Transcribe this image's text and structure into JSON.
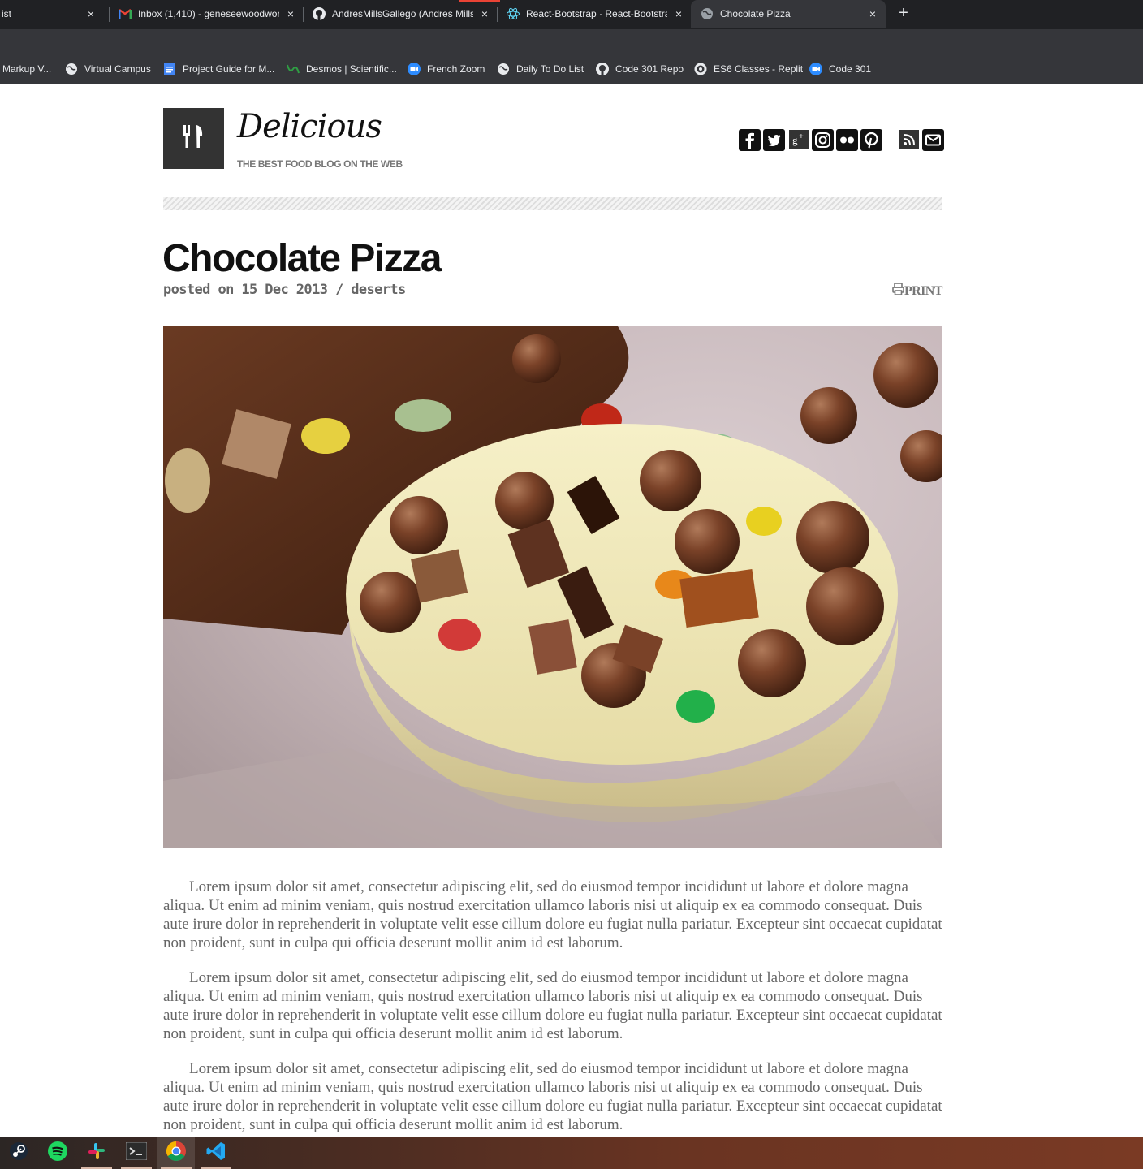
{
  "browser": {
    "tabs": [
      {
        "title": "ist",
        "icon": "page-icon"
      },
      {
        "title": "Inbox (1,410) - geneseewoodwor",
        "icon": "gmail-icon"
      },
      {
        "title": "AndresMillsGallego (Andres Mills",
        "icon": "github-icon"
      },
      {
        "title": "React-Bootstrap · React-Bootstrap",
        "icon": "react-bootstrap-icon"
      },
      {
        "title": "Chocolate Pizza",
        "icon": "globe-icon",
        "active": true
      }
    ],
    "new_tab_label": "+",
    "close_label": "×",
    "bookmarks": [
      {
        "label": "Markup V...",
        "icon": "page-icon"
      },
      {
        "label": "Virtual Campus",
        "icon": "globe-icon"
      },
      {
        "label": "Project Guide for M...",
        "icon": "docs-icon"
      },
      {
        "label": "Desmos | Scientific...",
        "icon": "desmos-icon"
      },
      {
        "label": "French Zoom",
        "icon": "zoom-icon"
      },
      {
        "label": "Daily To Do List",
        "icon": "globe-icon"
      },
      {
        "label": "Code 301 Repo",
        "icon": "github-icon"
      },
      {
        "label": "ES6 Classes - Replit",
        "icon": "replit-icon"
      },
      {
        "label": "Code 301",
        "icon": "zoom-icon"
      }
    ]
  },
  "site": {
    "brand": "Delicious",
    "tagline": "THE BEST FOOD BLOG ON THE WEB",
    "social_icons": [
      "facebook-icon",
      "twitter-icon",
      "google-plus-icon",
      "instagram-icon",
      "flickr-icon",
      "pinterest-icon",
      "rss-icon",
      "email-icon"
    ]
  },
  "post": {
    "title": "Chocolate Pizza",
    "meta": "posted on 15 Dec 2013 / deserts",
    "print_label": "PRINT",
    "paragraphs": [
      "Lorem ipsum dolor sit amet, consectetur adipiscing elit, sed do eiusmod tempor incididunt ut labore et dolore magna aliqua. Ut enim ad minim veniam, quis nostrud exercitation ullamco laboris nisi ut aliquip ex ea commodo consequat. Duis aute irure dolor in reprehenderit in voluptate velit esse cillum dolore eu fugiat nulla pariatur. Excepteur sint occaecat cupidatat non proident, sunt in culpa qui officia deserunt mollit anim id est laborum.",
      "Lorem ipsum dolor sit amet, consectetur adipiscing elit, sed do eiusmod tempor incididunt ut labore et dolore magna aliqua. Ut enim ad minim veniam, quis nostrud exercitation ullamco laboris nisi ut aliquip ex ea commodo consequat. Duis aute irure dolor in reprehenderit in voluptate velit esse cillum dolore eu fugiat nulla pariatur. Excepteur sint occaecat cupidatat non proident, sunt in culpa qui officia deserunt mollit anim id est laborum.",
      "Lorem ipsum dolor sit amet, consectetur adipiscing elit, sed do eiusmod tempor incididunt ut labore et dolore magna aliqua. Ut enim ad minim veniam, quis nostrud exercitation ullamco laboris nisi ut aliquip ex ea commodo consequat. Duis aute irure dolor in reprehenderit in voluptate velit esse cillum dolore eu fugiat nulla pariatur. Excepteur sint occaecat cupidatat non proident, sunt in culpa qui officia deserunt mollit anim id est laborum."
    ]
  },
  "taskbar": {
    "apps": [
      "steam-icon",
      "spotify-icon",
      "slack-icon",
      "terminal-icon",
      "chrome-icon",
      "vscode-icon"
    ]
  },
  "colors": {
    "chrome_bg": "#202124",
    "toolbar_bg": "#35363a",
    "logo_bg": "#333333",
    "meta_text": "#666666"
  }
}
